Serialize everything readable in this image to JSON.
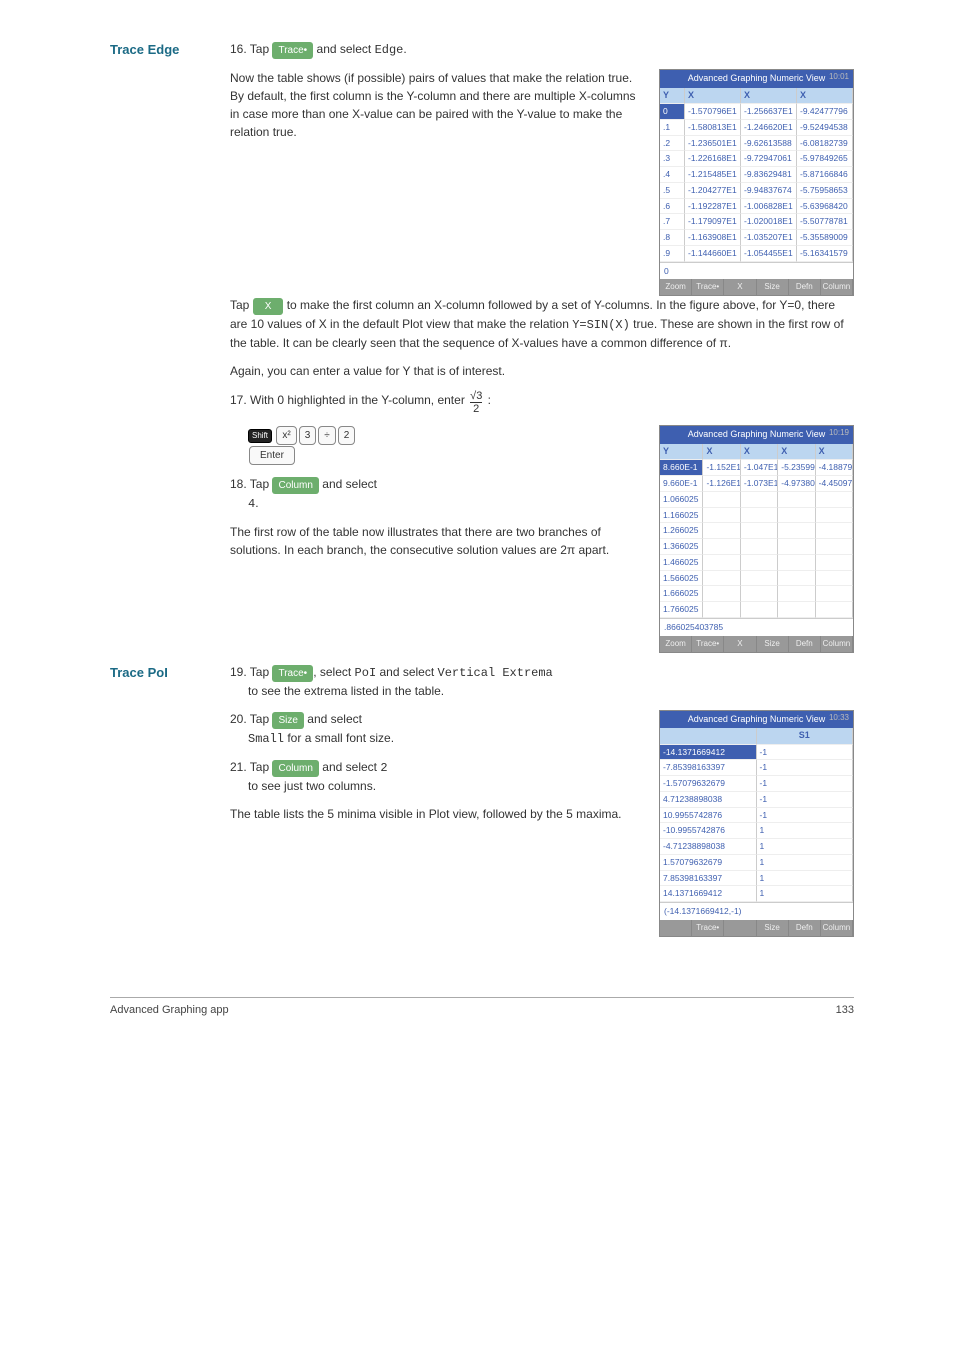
{
  "sections": {
    "traceEdge": {
      "heading": "Trace Edge",
      "step16_pre": "16. Tap ",
      "step16_traceLabel": "Trace•",
      "step16_post": " and select ",
      "step16_code": "Edge",
      "step16_period": ".",
      "para1": "Now the table shows (if possible) pairs of values that make the relation true. By default, the first column is the Y-column and there are multiple X-columns in case more than one X-value can be paired with the Y-value to make the relation true.",
      "para2_pre": "Tap ",
      "para2_xLabel": "X",
      "para2_mid": " to make the first column an X-column followed by a set of Y-columns. In the figure above, for Y=0, there are 10 values of X in the default Plot view that make the relation ",
      "para2_code": "Y=SIN(X)",
      "para2_post": " true. These are shown in the first row of the table. It can be clearly seen that the sequence of X-values have a common difference of π.",
      "para3": "Again, you can enter a value for Y that is of interest.",
      "step17_pre": "17. With 0 highlighted in the Y-column, enter ",
      "step17_colon": " :",
      "frac_top": "√3",
      "frac_bot": "2",
      "keys": {
        "shift": "Shift",
        "x2": "x²",
        "num3": "3",
        "div": "÷",
        "num2": "2",
        "enter": "Enter"
      },
      "step18_pre": "18. Tap ",
      "step18_columnLabel": "Column",
      "step18_post": " and select ",
      "step18_code": "4",
      "step18_period": ".",
      "para4": "The first row of the table now illustrates that there are two branches of solutions. In each branch, the consecutive solution values are 2π apart."
    },
    "tracePol": {
      "heading": "Trace PoI",
      "step19_pre": "19. Tap ",
      "step19_traceLabel": "Trace•",
      "step19_mid1": ", select ",
      "step19_code1": "PoI",
      "step19_mid2": " and select ",
      "step19_code2": "Vertical Extrema",
      "step19_post": " to see the extrema listed in the table.",
      "step20_pre": "20. Tap ",
      "step20_sizeLabel": "Size",
      "step20_mid": " and select ",
      "step20_code": "Small",
      "step20_post": " for a small font size.",
      "step21_pre": "21. Tap ",
      "step21_columnLabel": "Column",
      "step21_mid": " and select ",
      "step21_code": "2",
      "step21_post": " to see just two columns.",
      "para5": "The table lists the 5 minima visible in Plot view, followed by the 5 maxima."
    }
  },
  "screen1": {
    "title": "Advanced Graphing Numeric View",
    "time": "10:01",
    "headers": [
      "Y",
      "X",
      "X",
      "X"
    ],
    "rows": [
      [
        "0",
        "-1.570796E1",
        "-1.256637E1",
        "-9.42477796"
      ],
      [
        ".1",
        "-1.580813E1",
        "-1.246620E1",
        "-9.52494538"
      ],
      [
        ".2",
        "-1.236501E1",
        "-9.62613588",
        "-6.08182739"
      ],
      [
        ".3",
        "-1.226168E1",
        "-9.72947061",
        "-5.97849265"
      ],
      [
        ".4",
        "-1.215485E1",
        "-9.83629481",
        "-5.87166846"
      ],
      [
        ".5",
        "-1.204277E1",
        "-9.94837674",
        "-5.75958653"
      ],
      [
        ".6",
        "-1.192287E1",
        "-1.006828E1",
        "-5.63968420"
      ],
      [
        ".7",
        "-1.179097E1",
        "-1.020018E1",
        "-5.50778781"
      ],
      [
        ".8",
        "-1.163908E1",
        "-1.035207E1",
        "-5.35589009"
      ],
      [
        ".9",
        "-1.144660E1",
        "-1.054455E1",
        "-5.16341579"
      ]
    ],
    "input": "0",
    "menu": [
      "Zoom",
      "Trace•",
      "X",
      "Size",
      "Defn",
      "Column"
    ]
  },
  "screen2": {
    "title": "Advanced Graphing Numeric View",
    "time": "10:19",
    "headers": [
      "Y",
      "X",
      "X",
      "X",
      "X"
    ],
    "rows": [
      [
        "8.660E-1",
        "-1.152E1",
        "-1.047E1",
        "-5.23599",
        "-4.18879"
      ],
      [
        "9.660E-1",
        "-1.126E1",
        "-1.073E1",
        "-4.97380",
        "-4.45097"
      ],
      [
        "1.066025",
        "",
        "",
        "",
        ""
      ],
      [
        "1.166025",
        "",
        "",
        "",
        ""
      ],
      [
        "1.266025",
        "",
        "",
        "",
        ""
      ],
      [
        "1.366025",
        "",
        "",
        "",
        ""
      ],
      [
        "1.466025",
        "",
        "",
        "",
        ""
      ],
      [
        "1.566025",
        "",
        "",
        "",
        ""
      ],
      [
        "1.666025",
        "",
        "",
        "",
        ""
      ],
      [
        "1.766025",
        "",
        "",
        "",
        ""
      ]
    ],
    "input": ".866025403785",
    "menu": [
      "Zoom",
      "Trace•",
      "X",
      "Size",
      "Defn",
      "Column"
    ]
  },
  "screen3": {
    "title": "Advanced Graphing Numeric View",
    "time": "10:33",
    "headers": [
      "",
      "S1"
    ],
    "rows": [
      [
        "-14.1371669412",
        "-1"
      ],
      [
        "-7.85398163397",
        "-1"
      ],
      [
        "-1.57079632679",
        "-1"
      ],
      [
        "4.71238898038",
        "-1"
      ],
      [
        "10.9955742876",
        "-1"
      ],
      [
        "-10.9955742876",
        "1"
      ],
      [
        "-4.71238898038",
        "1"
      ],
      [
        "1.57079632679",
        "1"
      ],
      [
        "7.85398163397",
        "1"
      ],
      [
        "14.1371669412",
        "1"
      ]
    ],
    "input": "(-14.1371669412,-1)",
    "menu": [
      "",
      "Trace•",
      "",
      "Size",
      "Defn",
      "Column"
    ]
  },
  "footer": {
    "app": "Advanced Graphing app",
    "page": "133"
  }
}
